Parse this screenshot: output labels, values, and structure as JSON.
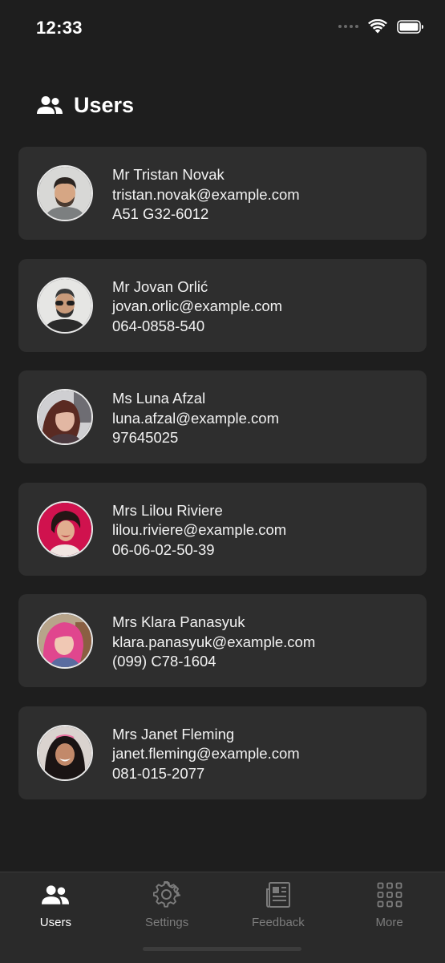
{
  "status_bar": {
    "time": "12:33"
  },
  "header": {
    "title": "Users",
    "icon": "users-icon"
  },
  "users": [
    {
      "name": "Mr Tristan Novak",
      "email": "tristan.novak@example.com",
      "phone": "A51 G32-6012"
    },
    {
      "name": "Mr Jovan Orlić",
      "email": "jovan.orlic@example.com",
      "phone": "064-0858-540"
    },
    {
      "name": "Ms Luna Afzal",
      "email": "luna.afzal@example.com",
      "phone": "97645025"
    },
    {
      "name": "Mrs Lilou Riviere",
      "email": "lilou.riviere@example.com",
      "phone": "06-06-02-50-39"
    },
    {
      "name": "Mrs Klara Panasyuk",
      "email": "klara.panasyuk@example.com",
      "phone": "(099) C78-1604"
    },
    {
      "name": "Mrs Janet Fleming",
      "email": "janet.fleming@example.com",
      "phone": "081-015-2077"
    }
  ],
  "tabs": [
    {
      "label": "Users",
      "icon": "users-icon",
      "active": true
    },
    {
      "label": "Settings",
      "icon": "gear-icon",
      "active": false
    },
    {
      "label": "Feedback",
      "icon": "newspaper-icon",
      "active": false
    },
    {
      "label": "More",
      "icon": "grid-icon",
      "active": false
    }
  ],
  "colors": {
    "background": "#1e1e1e",
    "card": "#2e2e2e",
    "tab_bar": "#2a2a2a",
    "inactive": "#7c7c7c",
    "active": "#ffffff"
  }
}
